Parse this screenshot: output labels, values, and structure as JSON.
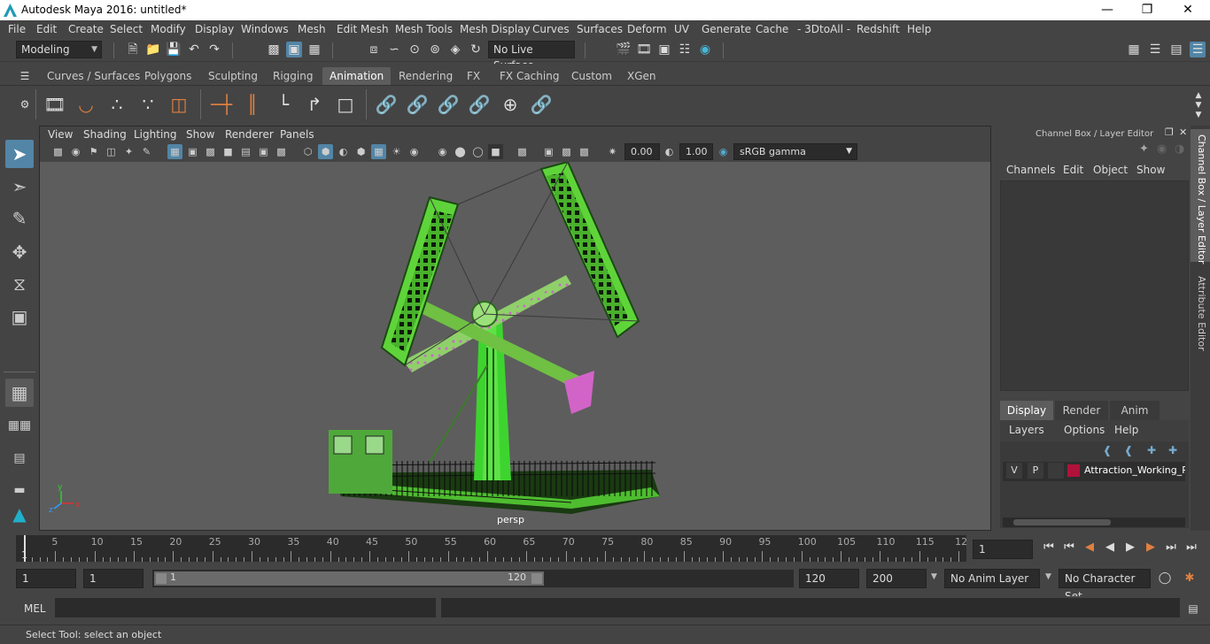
{
  "window": {
    "title": "Autodesk Maya 2016: untitled*"
  },
  "menus": [
    "File",
    "Edit",
    "Create",
    "Select",
    "Modify",
    "Display",
    "Windows",
    "Mesh",
    "Edit Mesh",
    "Mesh Tools",
    "Mesh Display",
    "Curves",
    "Surfaces",
    "Deform",
    "UV",
    "Generate",
    "Cache",
    "- 3DtoAll -",
    "Redshift",
    "Help"
  ],
  "statusline": {
    "mode": "Modeling",
    "live_surface": "No Live Surface"
  },
  "shelf_tabs": [
    "Curves / Surfaces",
    "Polygons",
    "Sculpting",
    "Rigging",
    "Animation",
    "Rendering",
    "FX",
    "FX Caching",
    "Custom",
    "XGen"
  ],
  "active_shelf_tab": "Animation",
  "panel_menus": [
    "View",
    "Shading",
    "Lighting",
    "Show",
    "Renderer",
    "Panels"
  ],
  "panel_toolbar": {
    "exposure": "0.00",
    "gamma": "1.00",
    "color_space": "sRGB gamma"
  },
  "viewport": {
    "camera": "persp"
  },
  "channel_box": {
    "title": "Channel Box / Layer Editor",
    "menus": [
      "Channels",
      "Edit",
      "Object",
      "Show"
    ],
    "layer_tabs": [
      "Display",
      "Render",
      "Anim"
    ],
    "active_layer_tab": "Display",
    "layer_menus": [
      "Layers",
      "Options",
      "Help"
    ],
    "layers": [
      {
        "v": "V",
        "p": "P",
        "name": "Attraction_Working_Pe",
        "color": "#b0123a"
      }
    ]
  },
  "side_tabs": [
    "Channel Box / Layer Editor",
    "Attribute Editor"
  ],
  "timeline": {
    "ticks": [
      "5",
      "10",
      "15",
      "20",
      "25",
      "30",
      "35",
      "40",
      "45",
      "50",
      "55",
      "60",
      "65",
      "70",
      "75",
      "80",
      "85",
      "90",
      "95",
      "100",
      "105",
      "110",
      "115",
      "12"
    ],
    "start_label": "1",
    "current_frame": "1"
  },
  "range": {
    "start": "1",
    "inner_start": "1",
    "slider_start": "1",
    "slider_end": "120",
    "end": "120",
    "outer_end": "200",
    "anim_layer": "No Anim Layer",
    "character_set": "No Character Set"
  },
  "command": {
    "label": "MEL"
  },
  "help_line": "Select Tool: select an object",
  "colors": {
    "accent": "#5285a6",
    "model_green": "#5fd43a"
  }
}
